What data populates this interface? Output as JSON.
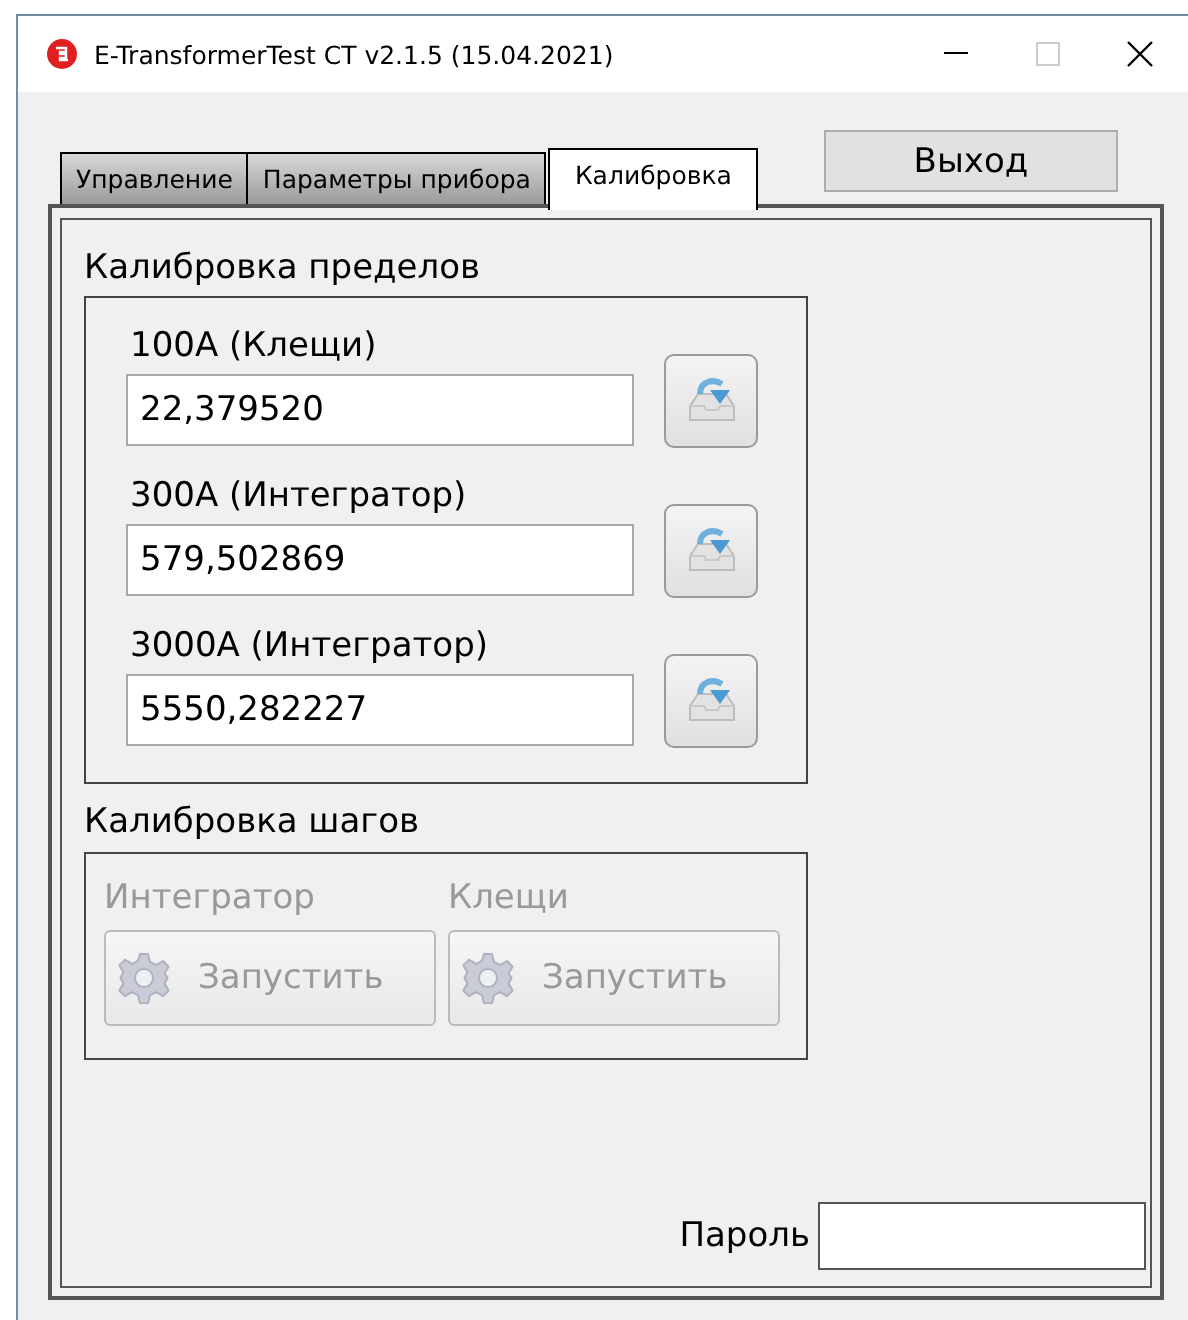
{
  "window": {
    "title": "E-TransformerTest CT v2.1.5 (15.04.2021)"
  },
  "tabs": [
    {
      "label": "Управление",
      "selected": false
    },
    {
      "label": "Параметры прибора",
      "selected": false
    },
    {
      "label": "Калибровка",
      "selected": true
    }
  ],
  "exit_button": "Выход",
  "range_calibration": {
    "title": "Калибровка пределов",
    "rows": [
      {
        "label": "100A (Клещи)",
        "value": "22,379520"
      },
      {
        "label": "300A (Интегратор)",
        "value": "579,502869"
      },
      {
        "label": "3000A (Интегратор)",
        "value": "5550,282227"
      }
    ]
  },
  "step_calibration": {
    "title": "Калибровка шагов",
    "items": [
      {
        "label": "Интегратор",
        "button": "Запустить",
        "disabled": true
      },
      {
        "label": "Клещи",
        "button": "Запустить",
        "disabled": true
      }
    ]
  },
  "password": {
    "label": "Пароль"
  }
}
